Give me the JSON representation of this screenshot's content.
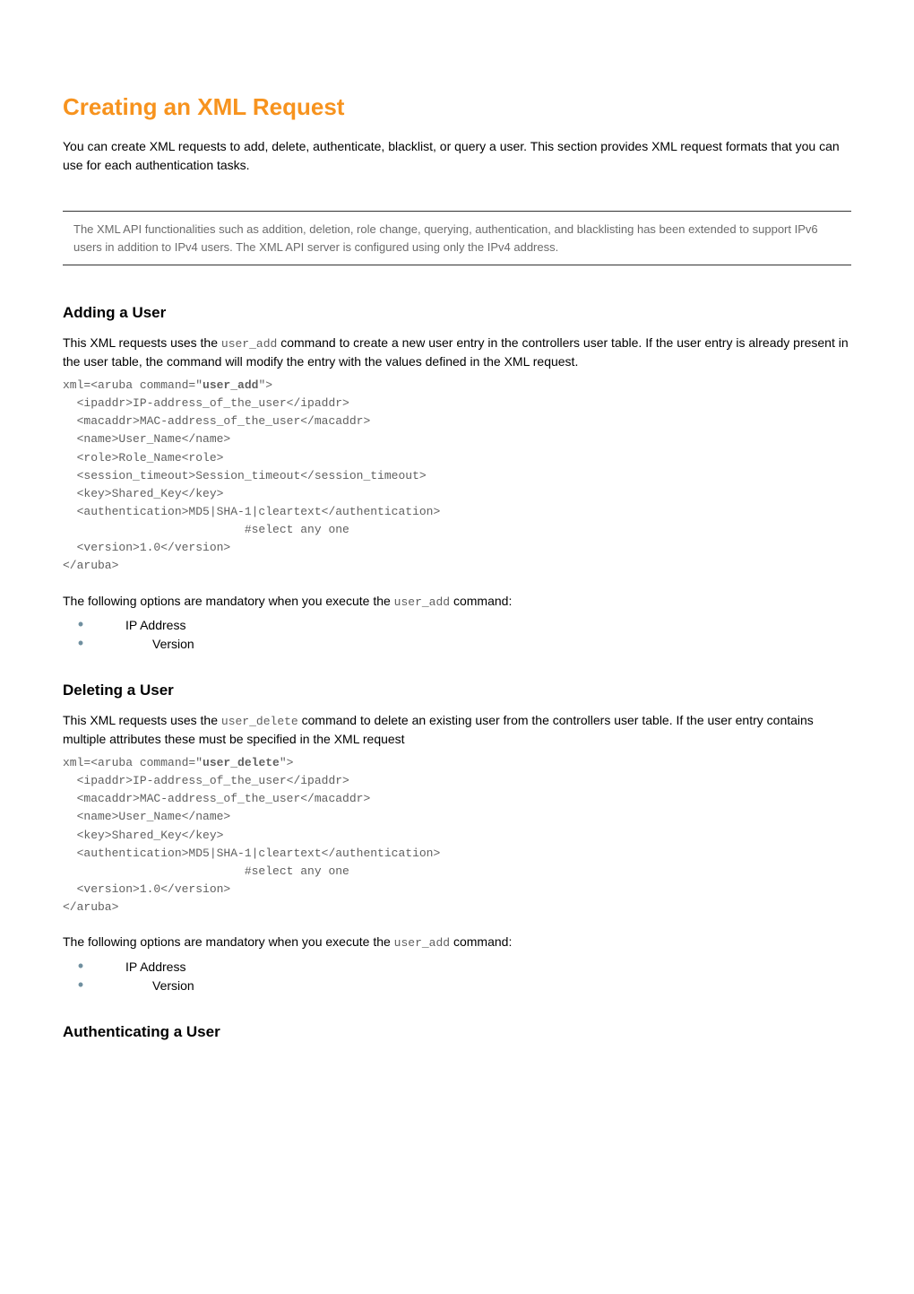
{
  "title": "Creating an XML Request",
  "intro": "You can create XML requests to add, delete, authenticate, blacklist, or query a user. This section provides XML request formats that you can use for each authentication tasks.",
  "note": "The XML API functionalities such as addition, deletion, role change, querying, authentication, and blacklisting has been extended to support IPv6 users in addition to IPv4 users. The XML API server is configured using only the IPv4 address.",
  "sections": {
    "add": {
      "heading": "Adding a User",
      "desc_pre": "This XML requests uses the ",
      "desc_cmd": "user_add",
      "desc_post": " command to create a new user entry in the controllers user table. If the user entry is already present in the user table, the command will modify the entry with the values defined in the XML request.",
      "code_prefix": "xml=<aruba command=\"",
      "code_cmd": "user_add",
      "code_body": "\">\n  <ipaddr>IP-address_of_the_user</ipaddr>\n  <macaddr>MAC-address_of_the_user</macaddr>\n  <name>User_Name</name>\n  <role>Role_Name<role>\n  <session_timeout>Session_timeout</session_timeout>\n  <key>Shared_Key</key>\n  <authentication>MD5|SHA-1|cleartext</authentication>\n                          #select any one\n  <version>1.0</version>\n</aruba>",
      "mandatory_pre": "The following options are mandatory when you execute the ",
      "mandatory_cmd": "user_add",
      "mandatory_post": " command:",
      "options": [
        "IP Address",
        "Version"
      ]
    },
    "delete": {
      "heading": "Deleting a User",
      "desc_pre": "This XML requests uses the ",
      "desc_cmd": "user_delete",
      "desc_post": " command to delete an existing user from the controllers user table. If the user entry contains multiple attributes these must be specified in the XML request",
      "code_prefix": "xml=<aruba command=\"",
      "code_cmd": "user_delete",
      "code_body": "\">\n  <ipaddr>IP-address_of_the_user</ipaddr>\n  <macaddr>MAC-address_of_the_user</macaddr>\n  <name>User_Name</name>\n  <key>Shared_Key</key>\n  <authentication>MD5|SHA-1|cleartext</authentication>\n                          #select any one\n  <version>1.0</version>\n</aruba>",
      "mandatory_pre": "The following options are mandatory when you execute the ",
      "mandatory_cmd": "user_add",
      "mandatory_post": "  command:",
      "options": [
        "IP Address",
        "Version"
      ]
    },
    "auth": {
      "heading": "Authenticating a User"
    }
  }
}
